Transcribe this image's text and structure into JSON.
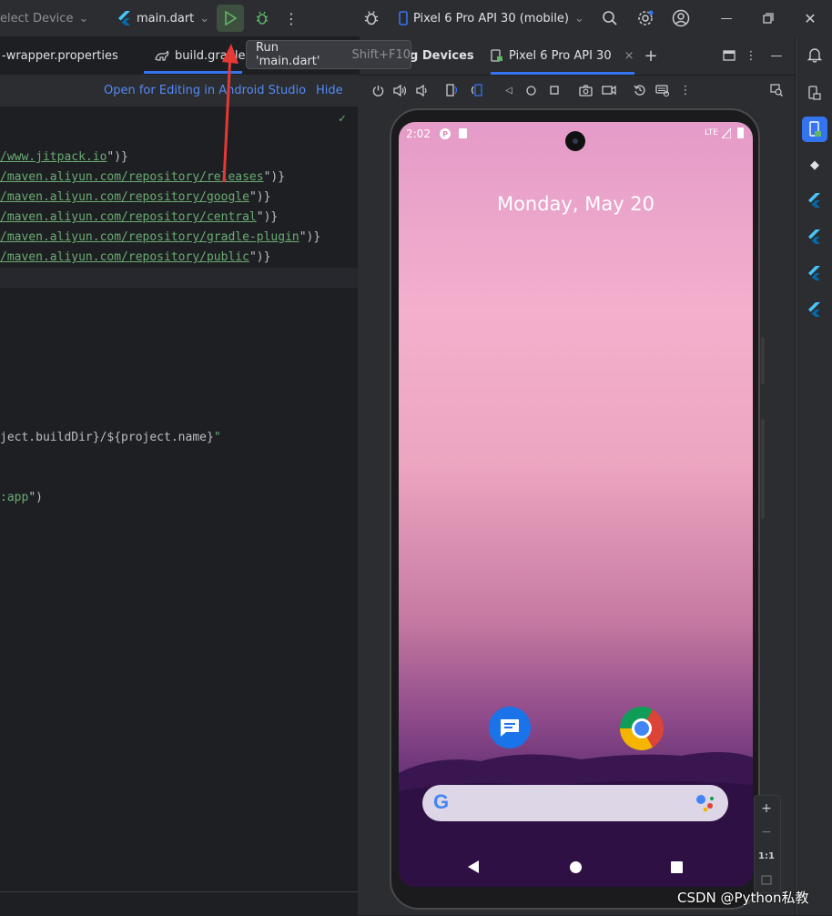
{
  "topbar": {
    "device_selector": "elect Device",
    "run_config": "main.dart",
    "device_running": "Pixel 6 Pro API 30 (mobile)"
  },
  "tabs": {
    "tab1": "-wrapper.properties",
    "tab2": "build.gradle",
    "tab3_suffix": "g Devices",
    "tab4": "Pixel 6 Pro API 30"
  },
  "tooltip": {
    "label": "Run 'main.dart'",
    "shortcut": "Shift+F10"
  },
  "banner": {
    "open_editing": "Open for Editing in Android Studio",
    "hide": "Hide"
  },
  "code": {
    "l1_url": "/www.jitpack.io",
    "l1_tail": "\")}",
    "l2_url": "/maven.aliyun.com/repository/releases",
    "l2_tail": "\")}",
    "l3_url": "/maven.aliyun.com/repository/google",
    "l3_tail": "\")}",
    "l4_url": "/maven.aliyun.com/repository/central",
    "l4_tail": "\")}",
    "l5_url": "/maven.aliyun.com/repository/gradle-plugin",
    "l5_tail": "\")}",
    "l6_url": "/maven.aliyun.com/repository/public",
    "l6_tail": "\")}",
    "l7_a": "ject.buildDir}/${project.name}",
    "l7_b": "\"",
    "l8_a": ":app",
    "l8_b": "\")"
  },
  "phone": {
    "time": "2:02",
    "network": "LTE",
    "date": "Monday, May 20"
  },
  "zoom": {
    "plus": "+",
    "minus": "−",
    "ratio": "1:1"
  },
  "watermark": "CSDN @Python私教",
  "colors": {
    "accent": "#3574f0",
    "run_green": "#5fb865",
    "arrow_red": "#e53935"
  }
}
